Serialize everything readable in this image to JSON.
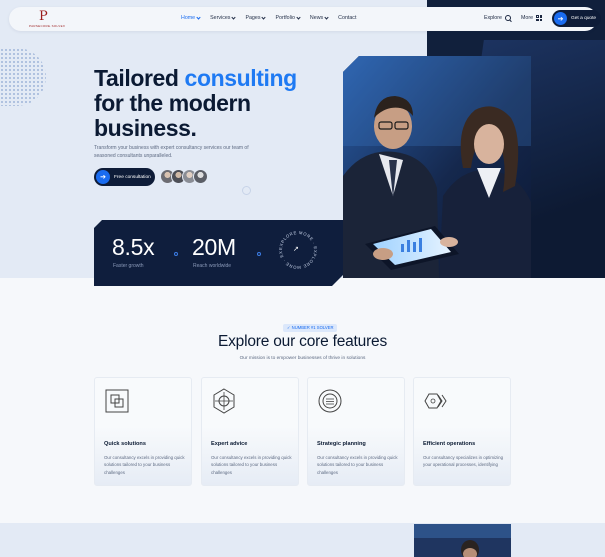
{
  "brand": {
    "logo_mark": "P",
    "logo_text": "PARSECORE·SOLVEX"
  },
  "nav": {
    "items": [
      {
        "label": "Home",
        "active": true,
        "dropdown": true
      },
      {
        "label": "Services",
        "active": false,
        "dropdown": true
      },
      {
        "label": "Pages",
        "active": false,
        "dropdown": true
      },
      {
        "label": "Portfolio",
        "active": false,
        "dropdown": true
      },
      {
        "label": "News",
        "active": false,
        "dropdown": true
      },
      {
        "label": "Contact",
        "active": false,
        "dropdown": false
      }
    ],
    "explore_label": "Explore",
    "more_label": "More",
    "quote_label": "Get a quote"
  },
  "hero": {
    "title_line1_plain": "Tailored ",
    "title_line1_accent": "consulting",
    "title_line2": "for the modern",
    "title_line3": "business.",
    "subtitle": "Transform your business with expert consultancy services our team of seasoned consultants unparalleled.",
    "cta_label": "Free consultation"
  },
  "stats": [
    {
      "value": "8.5x",
      "label": "Faster growth"
    },
    {
      "value": "20M",
      "label": "Reach worldwide"
    }
  ],
  "rotating_badge_text": "EXPLORE MORE · EXPLORE MORE · EXPLORE MORE ·",
  "features": {
    "tag": "✓ NUMBER #1 SOLVER",
    "title": "Explore our core features",
    "subtitle": "Our mission is to empower businesses of thrive in solutions",
    "cards": [
      {
        "title": "Quick solutions",
        "desc": "Our consultancy excels in providing quick solutions tailored to your business challenges",
        "icon": "layered-squares-icon"
      },
      {
        "title": "Expert advice",
        "desc": "Our consultancy excels in providing quick solutions tailored to your business challenges",
        "icon": "hexagon-target-icon"
      },
      {
        "title": "Strategic planning",
        "desc": "Our consultancy excels in providing quick solutions tailored to your business challenges",
        "icon": "concentric-circle-icon"
      },
      {
        "title": "Efficient operations",
        "desc": "Our consultancy specializes in optimizing your operational processes, identifying",
        "icon": "hexagon-chevrons-icon"
      }
    ]
  },
  "colors": {
    "accent": "#1f7af3",
    "navy": "#0f1e3d",
    "hero_bg": "#e3eaf5"
  }
}
